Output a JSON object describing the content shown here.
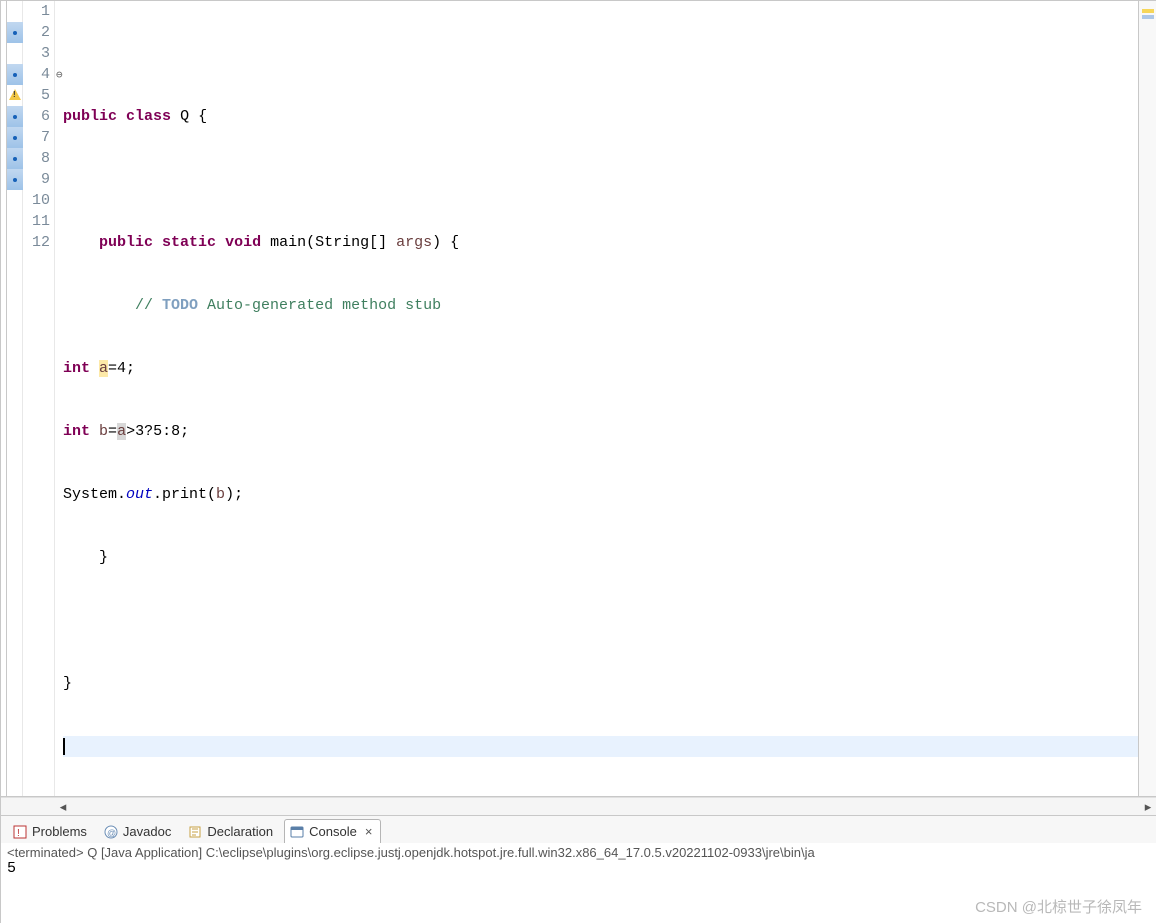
{
  "editor": {
    "line_numbers": [
      "1",
      "2",
      "3",
      "4",
      "5",
      "6",
      "7",
      "8",
      "9",
      "10",
      "11",
      "12"
    ],
    "fold_at_line": 4,
    "markers": {
      "blue_lines": [
        2,
        4,
        5,
        6,
        7,
        8,
        9
      ],
      "warning_line": 5
    },
    "cursor_line": 12,
    "occurrences": {
      "write_line": 6,
      "read_line": 7
    },
    "code": {
      "l1": "",
      "l2_kw1": "public",
      "l2_kw2": "class",
      "l2_name": "Q",
      "l2_brace": " {",
      "l3": "",
      "l4_indent": "    ",
      "l4_kw1": "public",
      "l4_kw2": "static",
      "l4_kw3": "void",
      "l4_name": " main",
      "l4_p1": "(",
      "l4_type": "String",
      "l4_arr": "[] ",
      "l4_arg": "args",
      "l4_p2": ") {",
      "l5_indent": "        ",
      "l5_c1": "// ",
      "l5_todo": "TODO",
      "l5_c2": " Auto-generated method stub",
      "l6_kw": "int",
      "l6_sp": " ",
      "l6_var": "a",
      "l6_rest": "=4;",
      "l7_kw": "int",
      "l7_sp": " ",
      "l7_var": "b",
      "l7_eq": "=",
      "l7_a": "a",
      "l7_rest": ">3?5:8;",
      "l8_sys": "System.",
      "l8_out": "out",
      "l8_print": ".print(",
      "l8_b": "b",
      "l8_end": ");",
      "l9_indent": "    ",
      "l9_brace": "}",
      "l10": "",
      "l11": "}",
      "l12": ""
    }
  },
  "views": {
    "tabs": [
      {
        "label": "Problems",
        "active": false
      },
      {
        "label": "Javadoc",
        "active": false
      },
      {
        "label": "Declaration",
        "active": false
      },
      {
        "label": "Console",
        "active": true
      }
    ]
  },
  "console": {
    "status": "<terminated> Q [Java Application] C:\\eclipse\\plugins\\org.eclipse.justj.openjdk.hotspot.jre.full.win32.x86_64_17.0.5.v20221102-0933\\jre\\bin\\ja",
    "output": "5"
  },
  "watermark": "CSDN @北椋世子徐凤年"
}
